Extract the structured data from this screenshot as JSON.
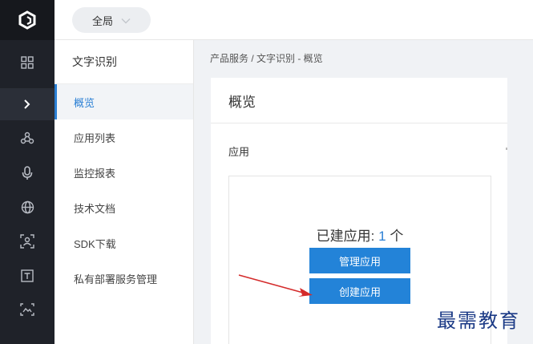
{
  "topbar": {
    "scope_label": "全局"
  },
  "sidebar": {
    "title": "文字识别",
    "items": [
      {
        "label": "概览",
        "active": true
      },
      {
        "label": "应用列表"
      },
      {
        "label": "监控报表"
      },
      {
        "label": "技术文档"
      },
      {
        "label": "SDK下载"
      },
      {
        "label": "私有部署服务管理"
      }
    ]
  },
  "rail": {
    "icons": [
      "logo-icon",
      "grid-icon",
      "chevron-right-icon",
      "nodes-icon",
      "microphone-icon",
      "globe-icon",
      "face-scan-icon",
      "text-box-icon",
      "image-scan-icon"
    ]
  },
  "breadcrumb": "产品服务 / 文字识别 - 概览",
  "main": {
    "title": "概览",
    "section_title": "应用",
    "apps_created_label": "已建应用:",
    "apps_created_count": "1",
    "apps_created_unit": "个",
    "manage_button": "管理应用",
    "create_button": "创建应用"
  },
  "watermark": "最需教育",
  "colors": {
    "accent": "#2a7fd4",
    "button": "#2383d8",
    "rail": "#1f2229",
    "annotation_arrow": "#d42b2b"
  }
}
